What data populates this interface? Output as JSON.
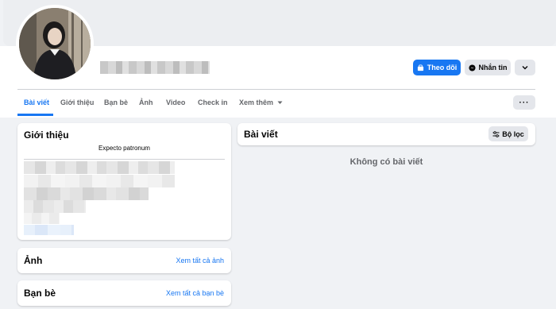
{
  "header": {
    "follow_label": "Theo dõi",
    "message_label": "Nhắn tin"
  },
  "tabs": [
    {
      "label": "Bài viết",
      "active": true
    },
    {
      "label": "Giới thiệu"
    },
    {
      "label": "Bạn bè"
    },
    {
      "label": "Ảnh"
    },
    {
      "label": "Video"
    },
    {
      "label": "Check in"
    },
    {
      "label": "Xem thêm"
    }
  ],
  "intro": {
    "title": "Giới thiệu",
    "bio": "Expecto patronum"
  },
  "photos": {
    "title": "Ảnh",
    "link": "Xem tất cả ảnh"
  },
  "friends": {
    "title": "Bạn bè",
    "link": "Xem tất cả bạn bè"
  },
  "posts": {
    "title": "Bài viết",
    "filter_label": "Bộ lọc",
    "empty_text": "Không có bài viết"
  },
  "colors": {
    "accent": "#1877f2",
    "background": "#f0f2f5",
    "button_gray": "#e4e6eb",
    "muted_text": "#65676b"
  }
}
